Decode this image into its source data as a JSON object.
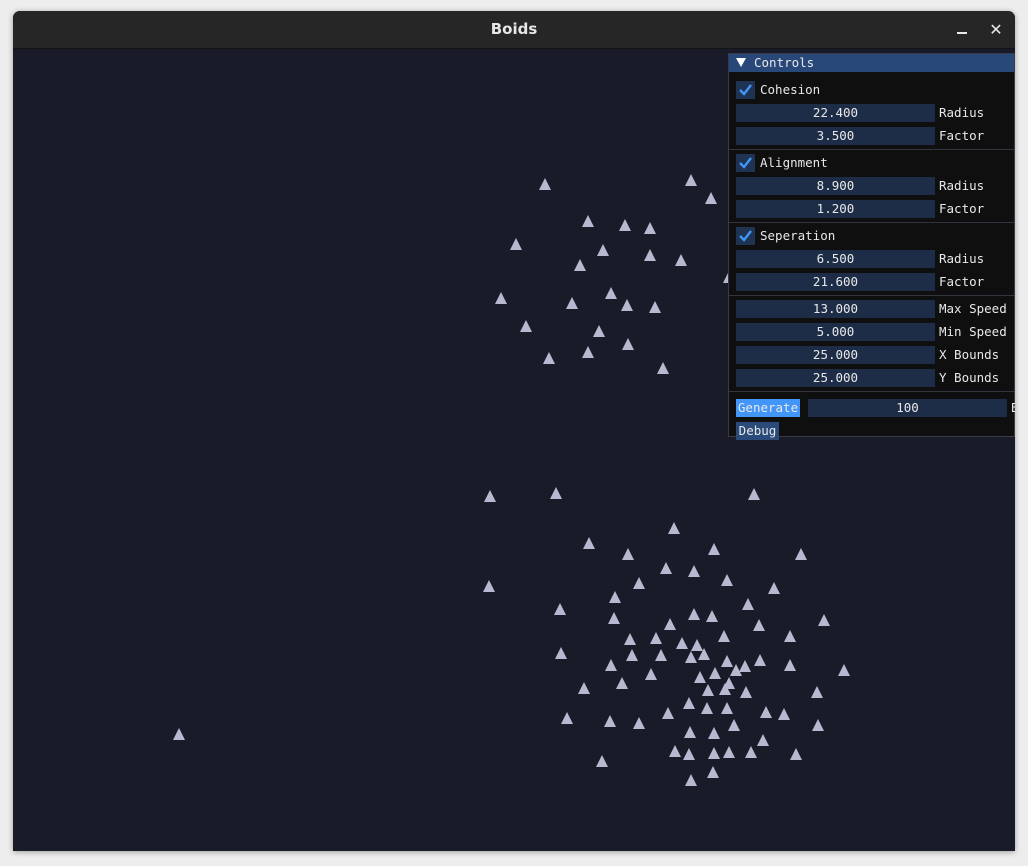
{
  "window": {
    "title": "Boids"
  },
  "panel": {
    "title": "Controls",
    "cohesion": {
      "label": "Cohesion",
      "checked": true,
      "radius": "22.400",
      "radius_label": "Radius",
      "factor": "3.500",
      "factor_label": "Factor"
    },
    "alignment": {
      "label": "Alignment",
      "checked": true,
      "radius": "8.900",
      "radius_label": "Radius",
      "factor": "1.200",
      "factor_label": "Factor"
    },
    "separation": {
      "label": "Seperation",
      "checked": true,
      "radius": "6.500",
      "radius_label": "Radius",
      "factor": "21.600",
      "factor_label": "Factor"
    },
    "max_speed": {
      "value": "13.000",
      "label": "Max Speed"
    },
    "min_speed": {
      "value": "5.000",
      "label": "Min Speed"
    },
    "x_bounds": {
      "value": "25.000",
      "label": "X Bounds"
    },
    "y_bounds": {
      "value": "25.000",
      "label": "Y Bounds"
    },
    "generate": {
      "label": "Generate",
      "count": "100",
      "count_label": "Boids"
    },
    "debug": {
      "label": "Debug"
    }
  },
  "colors": {
    "background": "#1a1b28",
    "boid": "#b8b9d1",
    "accent": "#4296fa",
    "header": "#29487a"
  }
}
